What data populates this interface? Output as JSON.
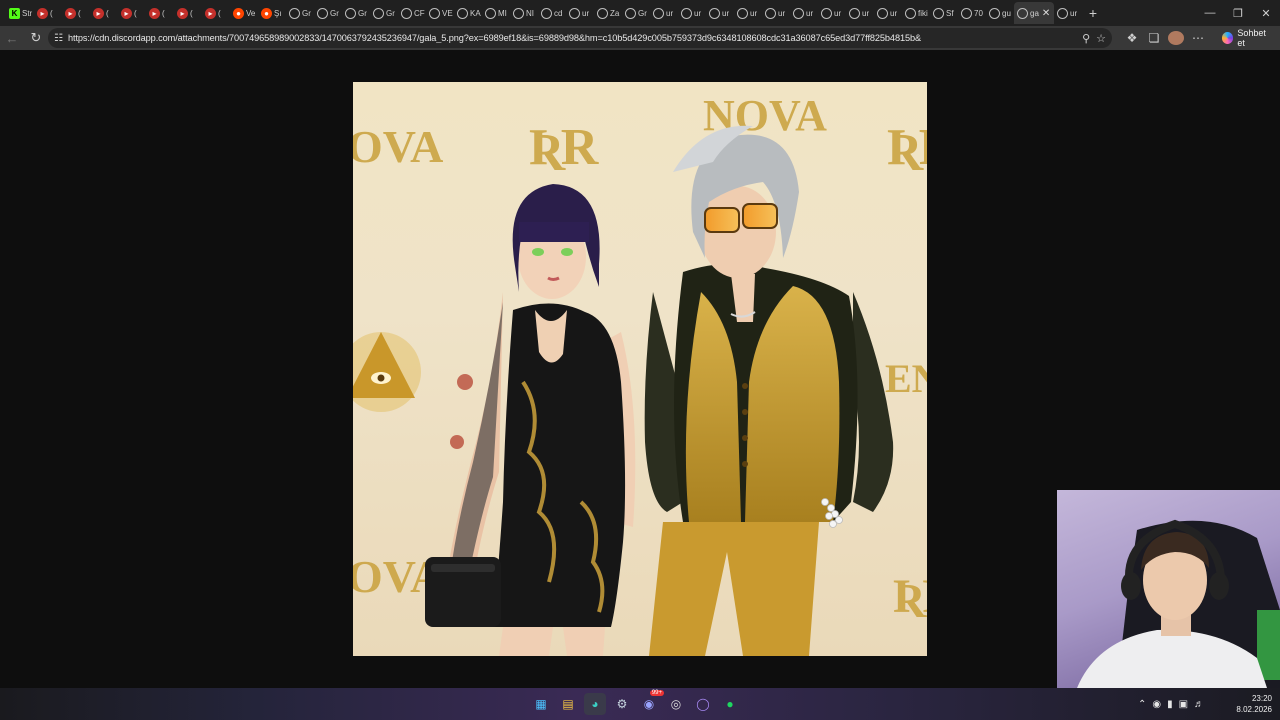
{
  "browser": {
    "tabs": [
      {
        "label": "Str",
        "favicon": "kick-icon"
      },
      {
        "label": "(",
        "favicon": "youtube-icon"
      },
      {
        "label": "(",
        "favicon": "youtube-icon"
      },
      {
        "label": "(",
        "favicon": "youtube-icon"
      },
      {
        "label": "(",
        "favicon": "youtube-icon"
      },
      {
        "label": "(",
        "favicon": "youtube-icon"
      },
      {
        "label": "(",
        "favicon": "youtube-icon"
      },
      {
        "label": "(",
        "favicon": "youtube-icon"
      },
      {
        "label": "Ve",
        "favicon": "reddit-icon"
      },
      {
        "label": "Şı",
        "favicon": "reddit-icon"
      },
      {
        "label": "Gr",
        "favicon": "globe-icon"
      },
      {
        "label": "Gr",
        "favicon": "globe-icon"
      },
      {
        "label": "Gr",
        "favicon": "globe-icon"
      },
      {
        "label": "Gr",
        "favicon": "globe-icon"
      },
      {
        "label": "CF",
        "favicon": "globe-icon"
      },
      {
        "label": "VE",
        "favicon": "globe-icon"
      },
      {
        "label": "KA",
        "favicon": "globe-icon"
      },
      {
        "label": "MI",
        "favicon": "globe-icon"
      },
      {
        "label": "NI",
        "favicon": "globe-icon"
      },
      {
        "label": "cd",
        "favicon": "globe-icon"
      },
      {
        "label": "ur",
        "favicon": "globe-icon"
      },
      {
        "label": "Za",
        "favicon": "globe-icon"
      },
      {
        "label": "Gr",
        "favicon": "globe-icon"
      },
      {
        "label": "ur",
        "favicon": "globe-icon"
      },
      {
        "label": "ur",
        "favicon": "globe-icon"
      },
      {
        "label": "ur",
        "favicon": "globe-icon"
      },
      {
        "label": "ur",
        "favicon": "globe-icon"
      },
      {
        "label": "ur",
        "favicon": "globe-icon"
      },
      {
        "label": "ur",
        "favicon": "globe-icon"
      },
      {
        "label": "ur",
        "favicon": "globe-icon"
      },
      {
        "label": "ur",
        "favicon": "globe-icon"
      },
      {
        "label": "ur",
        "favicon": "globe-icon"
      },
      {
        "label": "fiki",
        "favicon": "globe-icon"
      },
      {
        "label": "Sf",
        "favicon": "globe-icon"
      },
      {
        "label": "70",
        "favicon": "globe-icon"
      },
      {
        "label": "gu",
        "favicon": "globe-icon"
      },
      {
        "label": "ga",
        "favicon": "globe-icon",
        "active": true
      },
      {
        "label": "ur",
        "favicon": "globe-icon"
      }
    ],
    "url": "https://cdn.discordapp.com/attachments/700749658989002833/1470063792435236947/gala_5.png?ex=6989ef18&is=69889d98&hm=c10b5d429c005b759373d9c6348108608cdc31a36087c65ed3d77ff825b4815b&",
    "copilot_label": "Sohbet et"
  },
  "viewer": {
    "image_name": "gala_5.png",
    "backdrop_logos": [
      "OVA",
      "ƦR",
      "NOVA",
      "ƦR",
      "OVA",
      "ENI",
      "ƦR"
    ]
  },
  "taskbar": {
    "apps": [
      "start-icon",
      "file-explorer-icon",
      "edge-icon",
      "steam-icon",
      "discord-icon",
      "app-icon",
      "obs-icon",
      "spotify-icon"
    ],
    "discord_badge": "99+",
    "time": "23:20",
    "date": "8.02.2026"
  },
  "colors": {
    "tabstrip": "#202020",
    "toolbar": "#383838",
    "viewer_bg": "#0e0e0e",
    "gold": "#c9a13b"
  }
}
